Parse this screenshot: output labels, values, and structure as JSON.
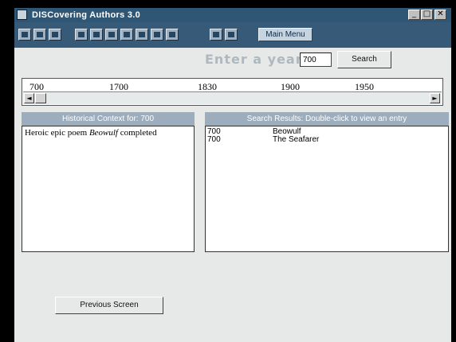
{
  "window": {
    "title": "DISCovering Authors 3.0",
    "controls": {
      "minimize": "_",
      "maximize": "□",
      "close": "✕"
    }
  },
  "toolbar": {
    "icons": [
      "save-icon",
      "print-icon",
      "help-icon",
      "tool-icon-1",
      "tool-icon-2",
      "tool-icon-3",
      "tool-icon-4",
      "tool-icon-5",
      "tool-icon-6",
      "tool-icon-7",
      "tool-icon-8",
      "tool-icon-9"
    ],
    "main_menu_label": "Main Menu"
  },
  "year_search": {
    "label": "Enter a year:",
    "value": "700",
    "button_label": "Search"
  },
  "timeline": {
    "ticks": [
      "700",
      "1700",
      "1830",
      "1900",
      "1950"
    ],
    "scroll_left": "◄",
    "scroll_right": "►"
  },
  "historical_context": {
    "header": "Historical Context for: 700",
    "text_prefix": "Heroic epic poem ",
    "text_italic": "Beowulf",
    "text_suffix": " completed"
  },
  "search_results": {
    "header": "Search Results: Double-click to view an entry",
    "rows": [
      {
        "year": "700",
        "title": "Beowulf"
      },
      {
        "year": "700",
        "title": "The Seafarer"
      }
    ]
  },
  "footer": {
    "previous_label": "Previous Screen"
  },
  "colors": {
    "titlebar": "#2f5674",
    "toolbar": "#365a78",
    "panel_header": "#9cadbd",
    "background": "#e6e9e8"
  }
}
